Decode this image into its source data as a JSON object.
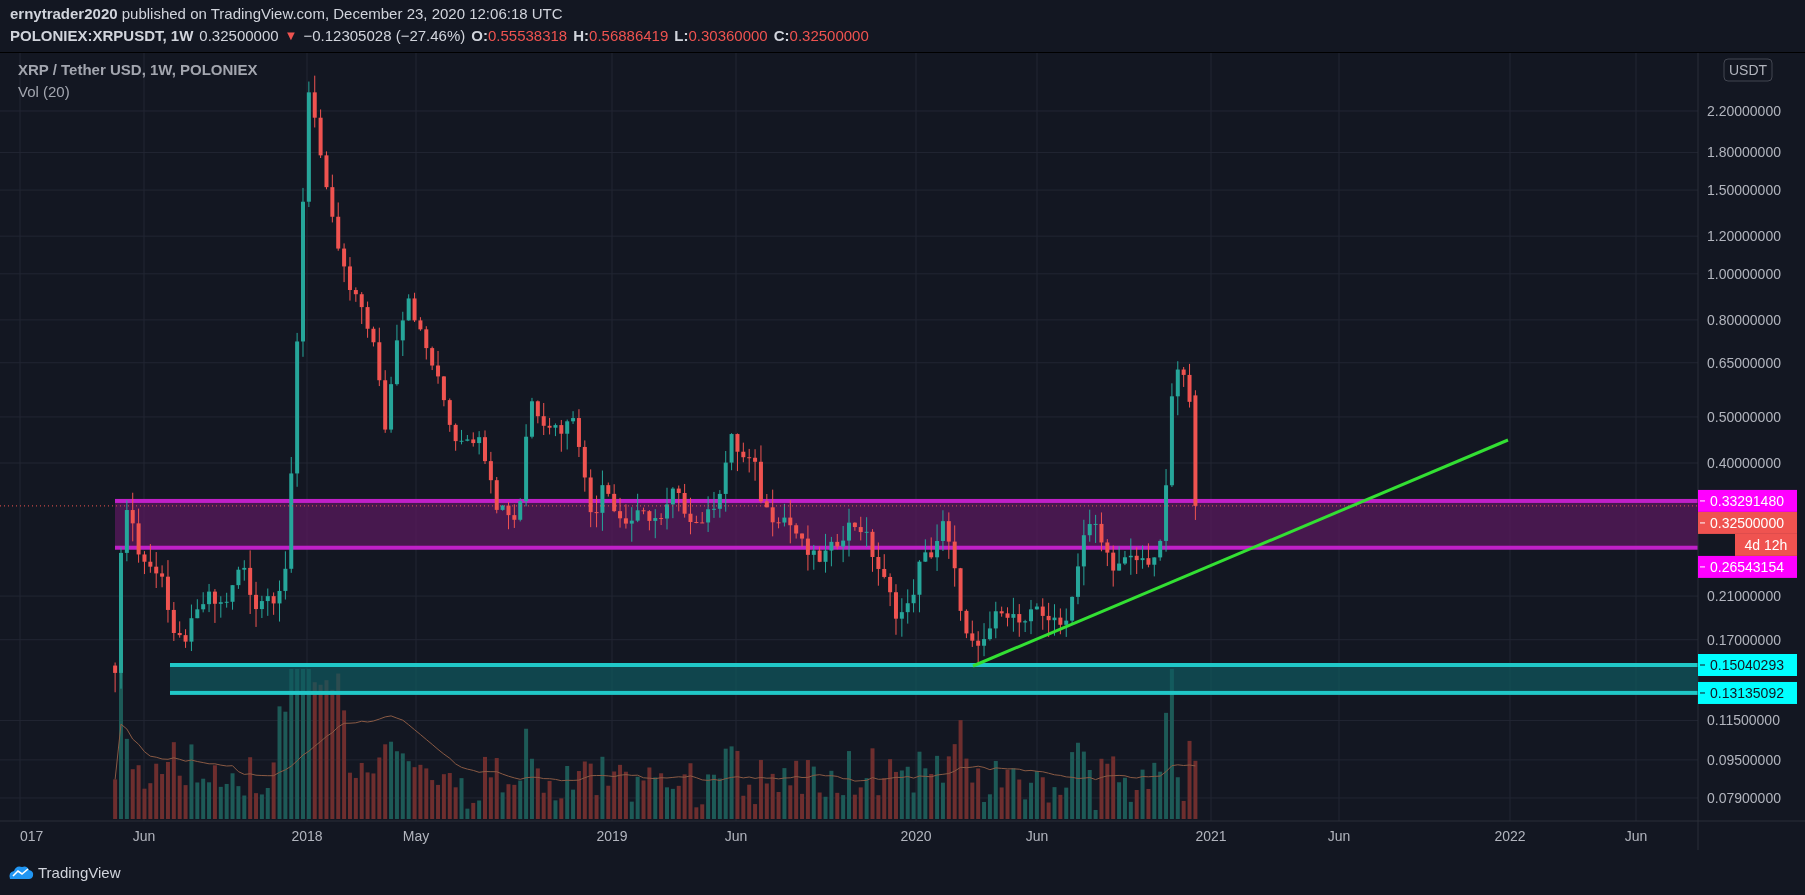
{
  "header": {
    "publish_line": "**ernytrader2020** published on TradingView.com, December 23, 2020 12:06:18 UTC",
    "symbol": "POLONIEX:XRPUSDT, 1W",
    "last_price": "0.32500000",
    "change_arrow": "▼",
    "change": "−0.12305028 (−27.46%)",
    "ohlc": [
      {
        "label": "O:",
        "value": "0.55538318"
      },
      {
        "label": "H:",
        "value": "0.56886419"
      },
      {
        "label": "L:",
        "value": "0.30360000"
      },
      {
        "label": "C:",
        "value": "0.32500000"
      }
    ]
  },
  "legend": {
    "title": "XRP / Tether USD, 1W, POLONIEX",
    "indicator": "Vol (20)"
  },
  "price_axis": {
    "currency": "USDT",
    "ticks": [
      "2.20000000",
      "1.80000000",
      "1.50000000",
      "1.20000000",
      "1.00000000",
      "0.80000000",
      "0.65000000",
      "0.50000000",
      "0.40000000",
      "0.21000000",
      "0.17000000",
      "0.11500000",
      "0.09500000",
      "0.07900000"
    ]
  },
  "price_labels": [
    {
      "text": "0.33291480",
      "color": "#ff00ff"
    },
    {
      "text": "0.32500000",
      "color": "#ef5350"
    },
    {
      "text": "0.26543154",
      "color": "#ff00ff"
    },
    {
      "text": "0.15040293",
      "color": "#00ffff"
    },
    {
      "text": "0.13135092",
      "color": "#00ffff"
    }
  ],
  "countdown": "4d 12h",
  "time_axis": [
    "017",
    "Jun",
    "2018",
    "May",
    "2019",
    "Jun",
    "2020",
    "Jun",
    "2021",
    "Jun",
    "2022",
    "Jun"
  ],
  "footer": {
    "brand": "TradingView"
  }
}
